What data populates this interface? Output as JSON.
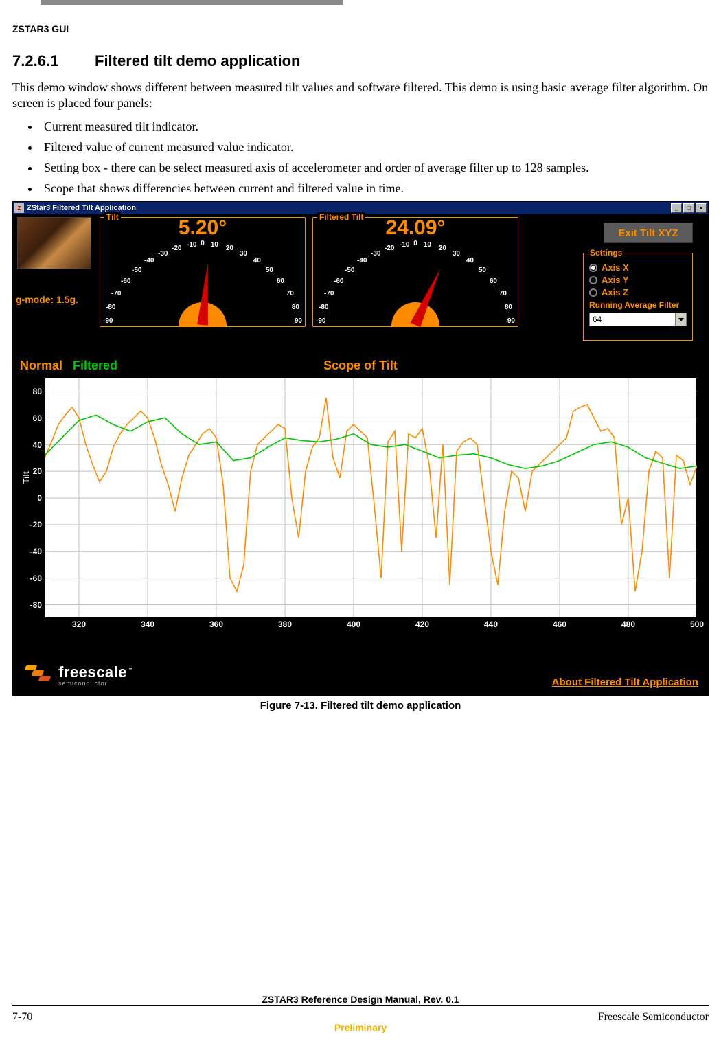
{
  "doc_header": "ZSTAR3 GUI",
  "section_number": "7.2.6.1",
  "section_title": "Filtered tilt demo application",
  "para": "This demo window shows different between measured tilt values and software filtered. This demo is using basic average filter algorithm. On screen is placed four panels:",
  "bullets": [
    "Current measured tilt indicator.",
    "Filtered value of current measured value indicator.",
    "Setting box - there can be select measured axis of accelerometer and order of average filter up to 128 samples.",
    "Scope that shows differencies between current and filtered value in time."
  ],
  "title_bar": "ZStar3 Filtered Tilt Application",
  "win_buttons": {
    "min": "_",
    "max": "□",
    "close": "×"
  },
  "gmode": "g-mode:   1.5g.",
  "gauge": {
    "tilt_label": "Tilt",
    "filtered_label": "Filtered Tilt",
    "tilt_value": "5.20°",
    "filtered_value": "24.09°",
    "ticks": {
      "n90": "-90",
      "n80": "-80",
      "n70": "-70",
      "n60": "-60",
      "n50": "-50",
      "n40": "-40",
      "n30": "-30",
      "n20": "-20",
      "n10": "-10",
      "z": "0",
      "p10": "10",
      "p20": "20",
      "p30": "30",
      "p40": "40",
      "p50": "50",
      "p60": "60",
      "p70": "70",
      "p80": "80",
      "p90": "90"
    }
  },
  "exit_btn": "Exit Tilt XYZ",
  "settings": {
    "legend": "Settings",
    "x": "Axis X",
    "y": "Axis Y",
    "z": "Axis Z",
    "raf": "Running Average Filter",
    "selected": "64"
  },
  "scope": {
    "normal": "Normal",
    "filtered": "Filtered",
    "title": "Scope of Tilt",
    "ylabel": "Tilt"
  },
  "about_link": "About Filtered Tilt Application",
  "fs_brand": "freescale",
  "fs_sub": "semiconductor",
  "figure_caption": "Figure 7-13. Filtered tilt demo application",
  "footer": {
    "mid": "ZSTAR3 Reference Design Manual, Rev. 0.1",
    "left": "7-70",
    "right": "Freescale Semiconductor",
    "prelim": "Preliminary"
  },
  "chart_data": {
    "type": "line",
    "title": "Scope of Tilt",
    "xlabel": "",
    "ylabel": "Tilt",
    "xlim": [
      310,
      500
    ],
    "ylim": [
      -90,
      90
    ],
    "xticks": [
      320,
      340,
      360,
      380,
      400,
      420,
      440,
      460,
      480,
      500
    ],
    "yticks": [
      -80,
      -60,
      -40,
      -20,
      0,
      20,
      40,
      60,
      80
    ],
    "series": [
      {
        "name": "Normal",
        "color": "#ff8c00",
        "x": [
          310,
          312,
          314,
          316,
          318,
          320,
          322,
          324,
          326,
          328,
          330,
          332,
          334,
          336,
          338,
          340,
          342,
          344,
          346,
          348,
          350,
          352,
          354,
          356,
          358,
          360,
          362,
          364,
          366,
          368,
          370,
          372,
          374,
          376,
          378,
          380,
          382,
          384,
          386,
          388,
          390,
          392,
          394,
          396,
          398,
          400,
          402,
          404,
          406,
          408,
          410,
          412,
          414,
          416,
          418,
          420,
          422,
          424,
          426,
          428,
          430,
          432,
          434,
          436,
          438,
          440,
          442,
          444,
          446,
          448,
          450,
          452,
          454,
          456,
          458,
          460,
          462,
          464,
          466,
          468,
          470,
          472,
          474,
          476,
          478,
          480,
          482,
          484,
          486,
          488,
          490,
          492,
          494,
          496,
          498,
          500
        ],
        "values": [
          30,
          42,
          55,
          62,
          68,
          60,
          40,
          25,
          12,
          20,
          38,
          48,
          55,
          60,
          65,
          60,
          45,
          25,
          10,
          -10,
          15,
          32,
          40,
          48,
          52,
          45,
          10,
          -60,
          -70,
          -50,
          20,
          40,
          45,
          50,
          55,
          52,
          0,
          -30,
          20,
          38,
          45,
          75,
          30,
          15,
          50,
          55,
          50,
          45,
          -5,
          -60,
          42,
          50,
          -40,
          48,
          45,
          52,
          25,
          -30,
          40,
          -65,
          35,
          42,
          45,
          40,
          0,
          -40,
          -65,
          -10,
          20,
          15,
          -10,
          20,
          25,
          30,
          35,
          40,
          45,
          65,
          68,
          70,
          60,
          50,
          52,
          45,
          -20,
          0,
          -70,
          -40,
          20,
          35,
          30,
          -60,
          32,
          28,
          10,
          24
        ]
      },
      {
        "name": "Filtered",
        "color": "#00c800",
        "x": [
          310,
          315,
          320,
          325,
          330,
          335,
          340,
          345,
          350,
          355,
          360,
          365,
          370,
          375,
          380,
          385,
          390,
          395,
          400,
          405,
          410,
          415,
          420,
          425,
          430,
          435,
          440,
          445,
          450,
          455,
          460,
          465,
          470,
          475,
          480,
          485,
          490,
          495,
          500
        ],
        "values": [
          32,
          45,
          58,
          62,
          55,
          50,
          57,
          60,
          48,
          40,
          42,
          28,
          30,
          38,
          45,
          43,
          42,
          44,
          48,
          40,
          38,
          40,
          35,
          30,
          32,
          33,
          30,
          25,
          22,
          24,
          28,
          34,
          40,
          42,
          38,
          30,
          26,
          22,
          24
        ]
      }
    ]
  }
}
